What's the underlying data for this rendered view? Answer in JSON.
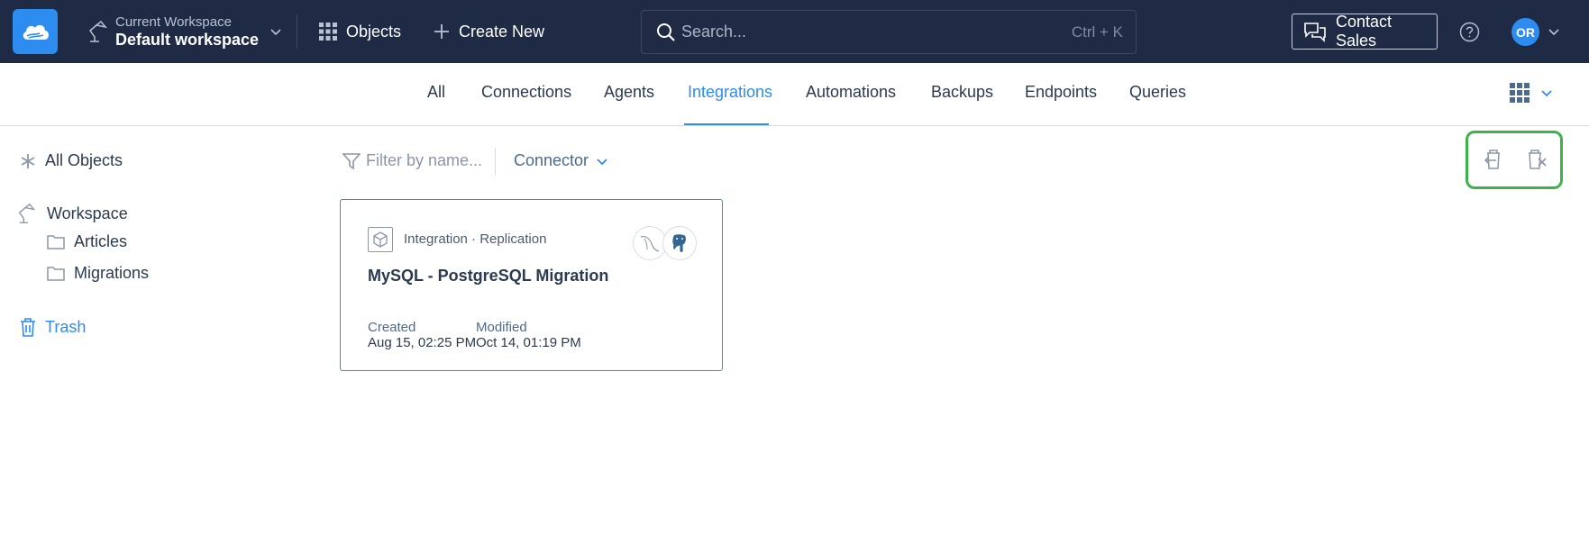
{
  "header": {
    "workspace_label": "Current Workspace",
    "workspace_name": "Default workspace",
    "objects_label": "Objects",
    "create_label": "Create New",
    "search_placeholder": "Search...",
    "search_shortcut": "Ctrl + K",
    "contact_label": "Contact Sales",
    "avatar_initials": "OR"
  },
  "tabs": [
    {
      "label": "All",
      "active": false
    },
    {
      "label": "Connections",
      "active": false
    },
    {
      "label": "Agents",
      "active": false
    },
    {
      "label": "Integrations",
      "active": true
    },
    {
      "label": "Automations",
      "active": false
    },
    {
      "label": "Backups",
      "active": false
    },
    {
      "label": "Endpoints",
      "active": false
    },
    {
      "label": "Queries",
      "active": false
    }
  ],
  "sidebar": {
    "all_objects": "All Objects",
    "workspace": "Workspace",
    "folders": [
      "Articles",
      "Migrations"
    ],
    "trash": "Trash"
  },
  "filters": {
    "name_placeholder": "Filter by name...",
    "connector_label": "Connector"
  },
  "card": {
    "type": "Integration · Replication",
    "title": "MySQL - PostgreSQL Migration",
    "created_label": "Created",
    "created_value": "Aug 15, 02:25 PM",
    "modified_label": "Modified",
    "modified_value": "Oct 14, 01:19 PM",
    "connectors": [
      "mysql-icon",
      "postgresql-icon"
    ]
  },
  "colors": {
    "topbar": "#1f2a44",
    "accent": "#2d8cf0",
    "highlight": "#3cb44b"
  }
}
